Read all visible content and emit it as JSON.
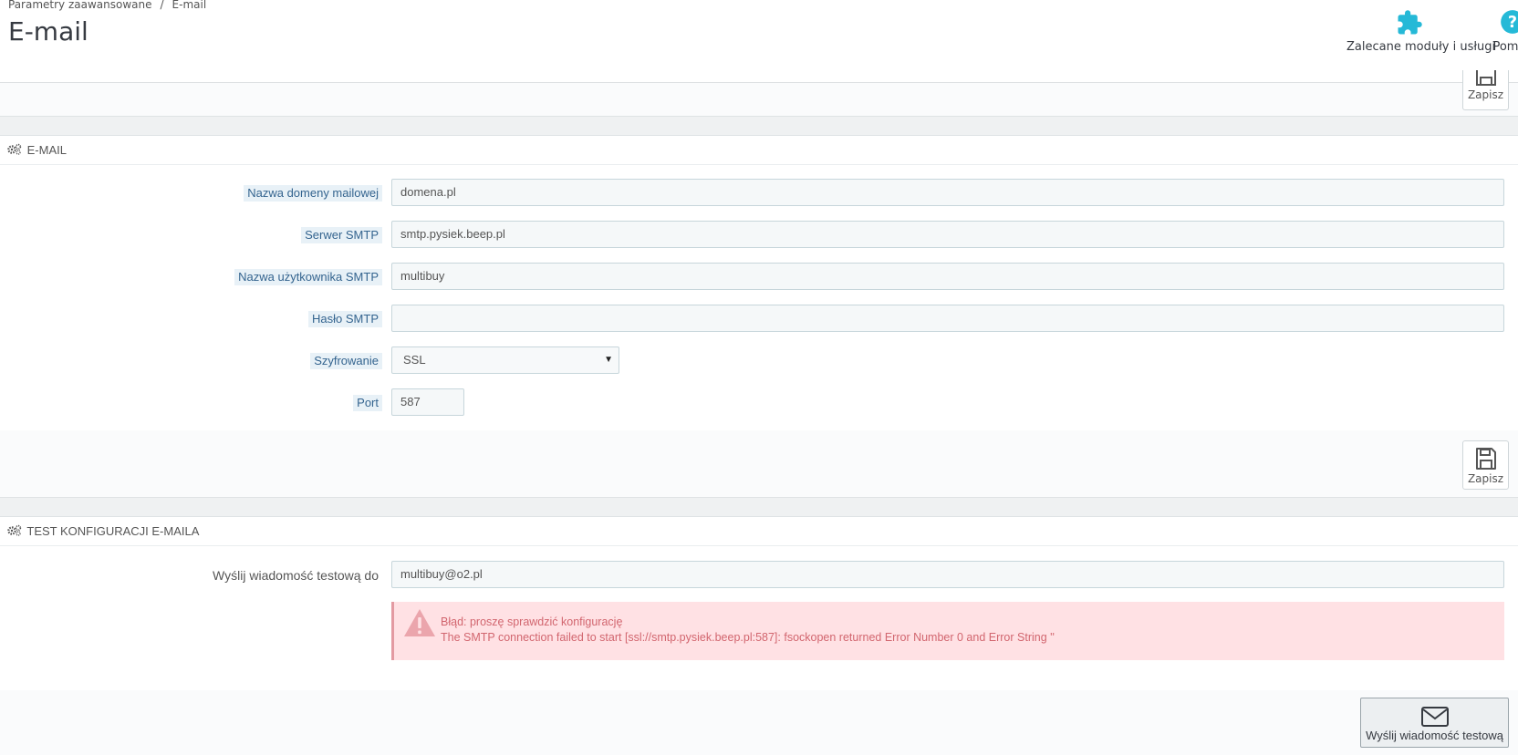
{
  "breadcrumb": {
    "parent": "Parametry zaawansowane",
    "separator": "/",
    "current": "E-mail"
  },
  "page_title": "E-mail",
  "toolbar": {
    "modules_label": "Zalecane moduły i usługi",
    "help_label": "Pomoc",
    "accent_color": "#25b9d7"
  },
  "top_panel": {
    "save_label": "Zapisz"
  },
  "email_panel": {
    "heading": "E-MAIL",
    "fields": {
      "domain": {
        "label": "Nazwa domeny mailowej",
        "value": "domena.pl"
      },
      "smtp_server": {
        "label": "Serwer SMTP",
        "value": "smtp.pysiek.beep.pl"
      },
      "smtp_user": {
        "label": "Nazwa użytkownika SMTP",
        "value": "multibuy"
      },
      "smtp_password": {
        "label": "Hasło SMTP",
        "value": ""
      },
      "encryption": {
        "label": "Szyfrowanie",
        "value": "SSL"
      },
      "port": {
        "label": "Port",
        "value": "587"
      }
    },
    "save_label": "Zapisz"
  },
  "test_panel": {
    "heading": "TEST KONFIGURACJI E-MAILA",
    "recipient": {
      "label": "Wyślij wiadomość testową do",
      "value": "multibuy@o2.pl"
    },
    "error": {
      "title": "Błąd: proszę sprawdzić konfigurację",
      "message": "The SMTP connection failed to start [ssl://smtp.pysiek.beep.pl:587]: fsockopen returned Error Number 0 and Error String ''"
    },
    "send_label": "Wyślij wiadomość testową"
  }
}
